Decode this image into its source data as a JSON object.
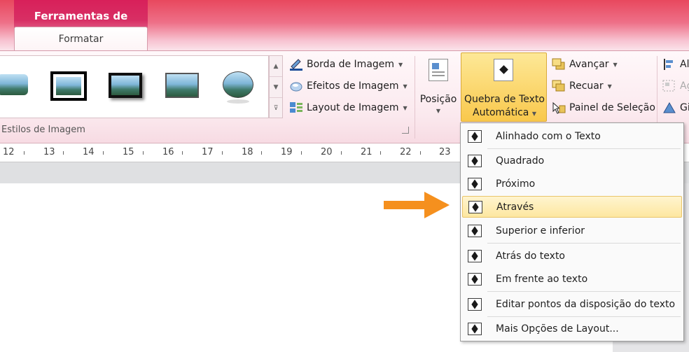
{
  "context_tab": {
    "group_title": "Ferramentas de Imagem",
    "tab_label": "Formatar"
  },
  "gallery": {
    "label": "Estilos de Imagem",
    "scroll_up": "▲",
    "scroll_down": "▼",
    "more": "⊽"
  },
  "commands_col1": {
    "borda": "Borda de Imagem",
    "efeitos": "Efeitos de Imagem",
    "layout": "Layout de Imagem"
  },
  "position_button": {
    "label": "Posição"
  },
  "wrap_button": {
    "line1": "Quebra de Texto",
    "line2": "Automática"
  },
  "commands_col2": {
    "avancar": "Avançar",
    "recuar": "Recuar",
    "painel": "Painel de Seleção"
  },
  "commands_col3": {
    "c1": "Al",
    "c2": "Ag",
    "c3": "Gi"
  },
  "ruler_ticks": [
    "12",
    "13",
    "14",
    "15",
    "16",
    "17",
    "18",
    "19",
    "20",
    "21",
    "22",
    "23"
  ],
  "wrap_menu": {
    "items": [
      "Alinhado com o Texto",
      "Quadrado",
      "Próximo",
      "Através",
      "Superior e inferior",
      "Atrás do texto",
      "Em frente ao texto",
      "Editar pontos da disposição do texto",
      "Mais Opções de Layout..."
    ],
    "highlighted_index": 3
  },
  "colors": {
    "accent_pink": "#d8205a",
    "highlight": "#fde7a0",
    "arrow": "#f5901e"
  }
}
